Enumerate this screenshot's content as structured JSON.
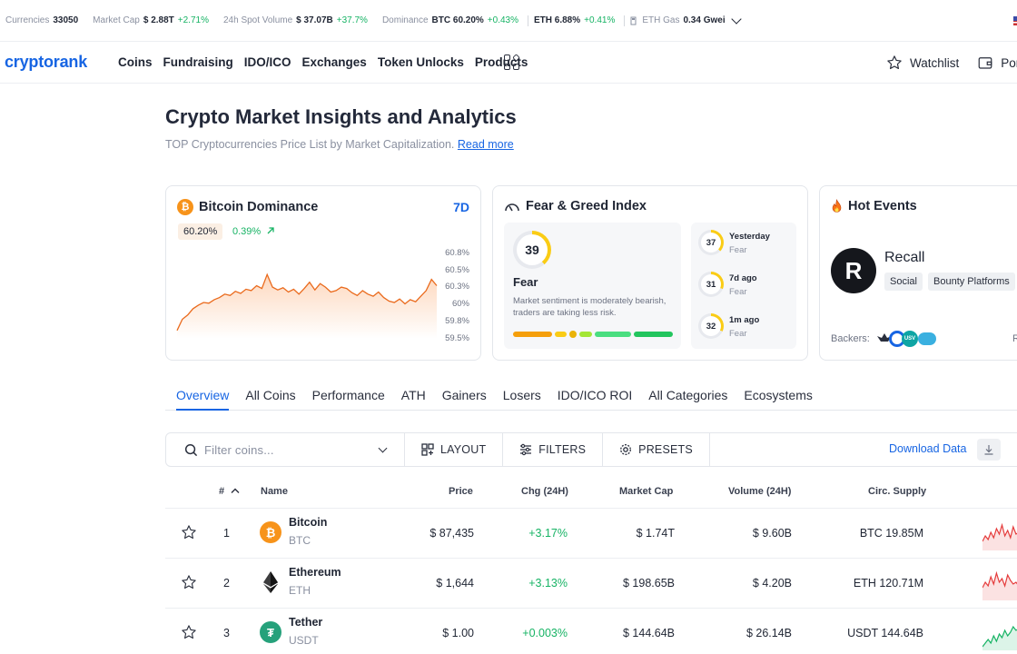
{
  "ticker": {
    "currencies_label": "Currencies",
    "currencies_value": "33050",
    "mcap_label": "Market Cap",
    "mcap_value": "$ 2.88T",
    "mcap_change": "+2.71%",
    "vol_label": "24h Spot Volume",
    "vol_value": "$ 37.07B",
    "vol_change": "+37.7%",
    "dom_label": "Dominance",
    "dom_btc": "BTC 60.20%",
    "dom_btc_change": "+0.43%",
    "dom_eth": "ETH 6.88%",
    "dom_eth_change": "+0.41%",
    "gas_label": "ETH Gas",
    "gas_value": "0.34 Gwei"
  },
  "nav": {
    "logo": "cryptorank",
    "items": [
      "Coins",
      "Fundraising",
      "IDO/ICO",
      "Exchanges",
      "Token Unlocks",
      "Products"
    ],
    "watchlist": "Watchlist",
    "portfolio": "Portfo"
  },
  "header": {
    "title": "Crypto Market Insights and Analytics",
    "subtitle": "TOP Cryptocurrencies Price List by Market Capitalization.",
    "read_more": "Read more"
  },
  "dominance": {
    "title": "Bitcoin Dominance",
    "range": "7D",
    "value": "60.20%",
    "change": "0.39%",
    "y_labels": [
      "60.8%",
      "60.5%",
      "60.3%",
      "60%",
      "59.8%",
      "59.5%"
    ],
    "chart_data": {
      "type": "area",
      "ylim": [
        59.5,
        60.8
      ],
      "values": [
        59.62,
        59.78,
        59.84,
        59.93,
        59.98,
        60.02,
        60.01,
        60.06,
        60.09,
        60.14,
        60.12,
        60.18,
        60.15,
        60.21,
        60.19,
        60.26,
        60.22,
        60.42,
        60.24,
        60.2,
        60.23,
        60.17,
        60.21,
        60.14,
        60.22,
        60.31,
        60.2,
        60.29,
        60.24,
        60.17,
        60.19,
        60.24,
        60.22,
        60.16,
        60.12,
        60.19,
        60.14,
        60.11,
        60.17,
        60.09,
        60.04,
        60.02,
        60.07,
        60.0,
        60.06,
        60.03,
        60.11,
        60.19,
        60.35,
        60.26
      ]
    }
  },
  "fear_greed": {
    "title": "Fear & Greed Index",
    "value": "39",
    "label": "Fear",
    "description": "Market sentiment is moderately bearish, traders are taking less risk.",
    "level": 0.39,
    "history": [
      {
        "value": "37",
        "when": "Yesterday",
        "label": "Fear",
        "level": 0.37
      },
      {
        "value": "31",
        "when": "7d ago",
        "label": "Fear",
        "level": 0.31
      },
      {
        "value": "32",
        "when": "1m ago",
        "label": "Fear",
        "level": 0.32
      }
    ],
    "colors": [
      "#f59f0a",
      "#facc15",
      "#facc15",
      "#a3e635",
      "#4ade80",
      "#22c55e"
    ]
  },
  "hot_events": {
    "title": "Hot Events",
    "name": "Recall",
    "tags": [
      "Social",
      "Bounty Platforms"
    ],
    "backers_label": "Backers:",
    "backer_badge": "USV",
    "cut_text": "R"
  },
  "tabs": [
    "Overview",
    "All Coins",
    "Performance",
    "ATH",
    "Gainers",
    "Losers",
    "IDO/ICO ROI",
    "All Categories",
    "Ecosystems"
  ],
  "toolbar": {
    "search_placeholder": "Filter coins...",
    "layout": "LAYOUT",
    "filters": "FILTERS",
    "presets": "PRESETS",
    "download": "Download Data"
  },
  "table": {
    "headers": {
      "rank": "#",
      "name": "Name",
      "price": "Price",
      "chg": "Chg (24H)",
      "mcap": "Market Cap",
      "vol": "Volume (24H)",
      "supply": "Circ. Supply"
    },
    "rows": [
      {
        "rank": "1",
        "name": "Bitcoin",
        "symbol": "BTC",
        "price": "$ 87,435",
        "chg": "+3.17%",
        "mcap": "$ 1.74T",
        "vol": "$ 9.60B",
        "supply": "BTC 19.85M",
        "icon": "btc-icon",
        "color": "#f7931a",
        "glyph": "₿",
        "spark": "#e53b3b"
      },
      {
        "rank": "2",
        "name": "Ethereum",
        "symbol": "ETH",
        "price": "$ 1,644",
        "chg": "+3.13%",
        "mcap": "$ 198.65B",
        "vol": "$ 4.20B",
        "supply": "ETH 120.71M",
        "icon": "eth-icon",
        "color": "#ffffff",
        "glyph": "",
        "spark": "#e53b3b"
      },
      {
        "rank": "3",
        "name": "Tether",
        "symbol": "USDT",
        "price": "$ 1.00",
        "chg": "+0.003%",
        "mcap": "$ 144.64B",
        "vol": "$ 26.14B",
        "supply": "USDT 144.64B",
        "icon": "usdt-icon",
        "color": "#26a17b",
        "glyph": "₮",
        "spark": "#16b364"
      }
    ]
  }
}
